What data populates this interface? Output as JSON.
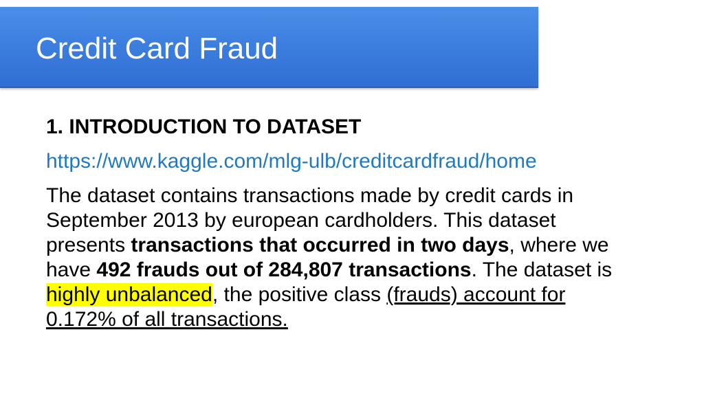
{
  "slide": {
    "title": "Credit Card Fraud",
    "heading": "1. INTRODUCTION TO DATASET",
    "link": "https://www.kaggle.com/mlg-ulb/creditcardfraud/home",
    "paragraph": {
      "p1": "The dataset contains transactions made by credit cards in September 2013 by european cardholders. This dataset presents ",
      "b1": "transactions that occurred in two days",
      "p2": ", where we have ",
      "b2": "492 frauds out of 284,807 transactions",
      "p3": ". The dataset is ",
      "highlight": "highly unbalanced",
      "p4": ", the positive class ",
      "underlined": "(frauds) account for 0.172% of all transactions."
    }
  },
  "colors": {
    "title_bar": "#3d7fdf",
    "link": "#1f7ac1",
    "highlight": "#ffff00"
  }
}
